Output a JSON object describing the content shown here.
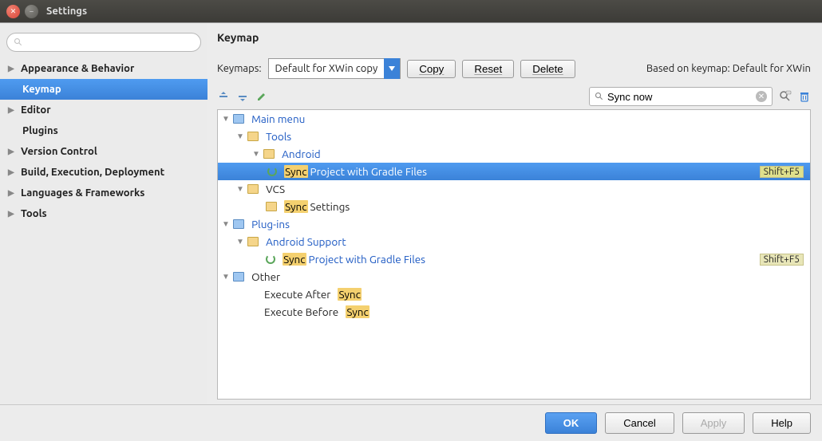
{
  "window": {
    "title": "Settings"
  },
  "sidebar": {
    "search_placeholder": "",
    "items": [
      {
        "label": "Appearance & Behavior",
        "has_children": true
      },
      {
        "label": "Keymap",
        "has_children": false,
        "selected": true
      },
      {
        "label": "Editor",
        "has_children": true
      },
      {
        "label": "Plugins",
        "has_children": false
      },
      {
        "label": "Version Control",
        "has_children": true
      },
      {
        "label": "Build, Execution, Deployment",
        "has_children": true
      },
      {
        "label": "Languages & Frameworks",
        "has_children": true
      },
      {
        "label": "Tools",
        "has_children": true
      }
    ]
  },
  "main": {
    "title": "Keymap",
    "keymaps_label": "Keymaps:",
    "keymap_selected": "Default for XWin copy",
    "copy_btn": "Copy",
    "reset_btn": "Reset",
    "delete_btn": "Delete",
    "based_on": "Based on keymap: Default for XWin",
    "search_value": "Sync now"
  },
  "tree": {
    "main_menu": "Main menu",
    "tools": "Tools",
    "android": "Android",
    "sync_gradle_pre": "Sync",
    "sync_gradle_post": " Project with Gradle Files",
    "shift_f5": "Shift+F5",
    "vcs": "VCS",
    "sync_settings_pre": "Sync",
    "sync_settings_post": " Settings",
    "plugins": "Plug-ins",
    "android_support": "Android Support",
    "other": "Other",
    "exec_after_pre": "Execute After ",
    "exec_after_hl": "Sync",
    "exec_before_pre": "Execute Before ",
    "exec_before_hl": "Sync"
  },
  "footer": {
    "ok": "OK",
    "cancel": "Cancel",
    "apply": "Apply",
    "help": "Help"
  }
}
